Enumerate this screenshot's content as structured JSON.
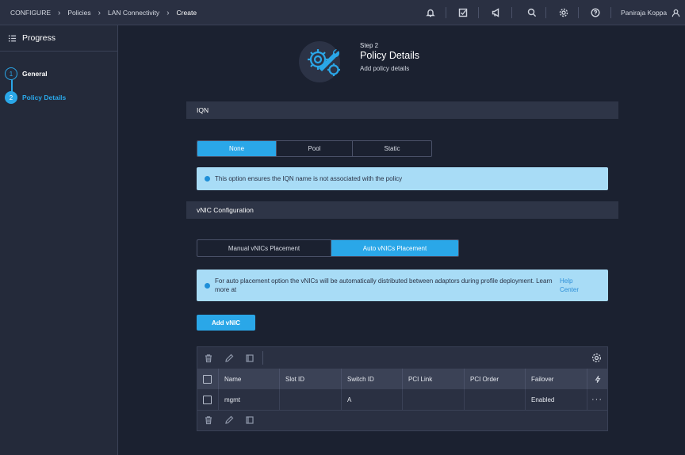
{
  "header": {
    "breadcrumbs": [
      "CONFIGURE",
      "Policies",
      "LAN Connectivity",
      "Create"
    ],
    "icons": [
      "bell-icon",
      "checklist-icon",
      "megaphone-icon",
      "search-icon",
      "gear-icon",
      "help-icon"
    ],
    "user_name": "Paniraja Koppa"
  },
  "sidebar": {
    "title": "Progress",
    "steps": [
      {
        "number": "1",
        "label": "General",
        "state": "completed"
      },
      {
        "number": "2",
        "label": "Policy Details",
        "state": "active"
      }
    ]
  },
  "main": {
    "step_sub": "Step 2",
    "step_title": "Policy Details",
    "step_desc": "Add policy details",
    "iqn": {
      "section_title": "IQN",
      "options": [
        "None",
        "Pool",
        "Static"
      ],
      "selected": "None",
      "info_text": "This option ensures the IQN name is not associated with the policy"
    },
    "vnic": {
      "section_title": "vNIC Configuration",
      "options": [
        "Manual vNICs Placement",
        "Auto vNICs Placement"
      ],
      "selected": "Auto vNICs Placement",
      "info_text_line1": "For auto placement option the vNICs will be automatically distributed between adaptors during profile deployment. Learn",
      "info_text_line2": "more at",
      "info_link_line1": "Help",
      "info_link_line2": "Center",
      "add_button": "Add vNIC"
    },
    "table": {
      "columns": [
        "Name",
        "Slot ID",
        "Switch ID",
        "PCI Link",
        "PCI Order",
        "Failover"
      ],
      "rows": [
        {
          "name": "mgmt",
          "slot_id": "",
          "switch_id": "A",
          "pci_link": "",
          "pci_order": "",
          "failover": "Enabled",
          "actions": "···"
        }
      ]
    }
  },
  "colors": {
    "accent": "#2aa7e8",
    "background": "#1b2130",
    "info_bg": "#a8dcf6"
  }
}
